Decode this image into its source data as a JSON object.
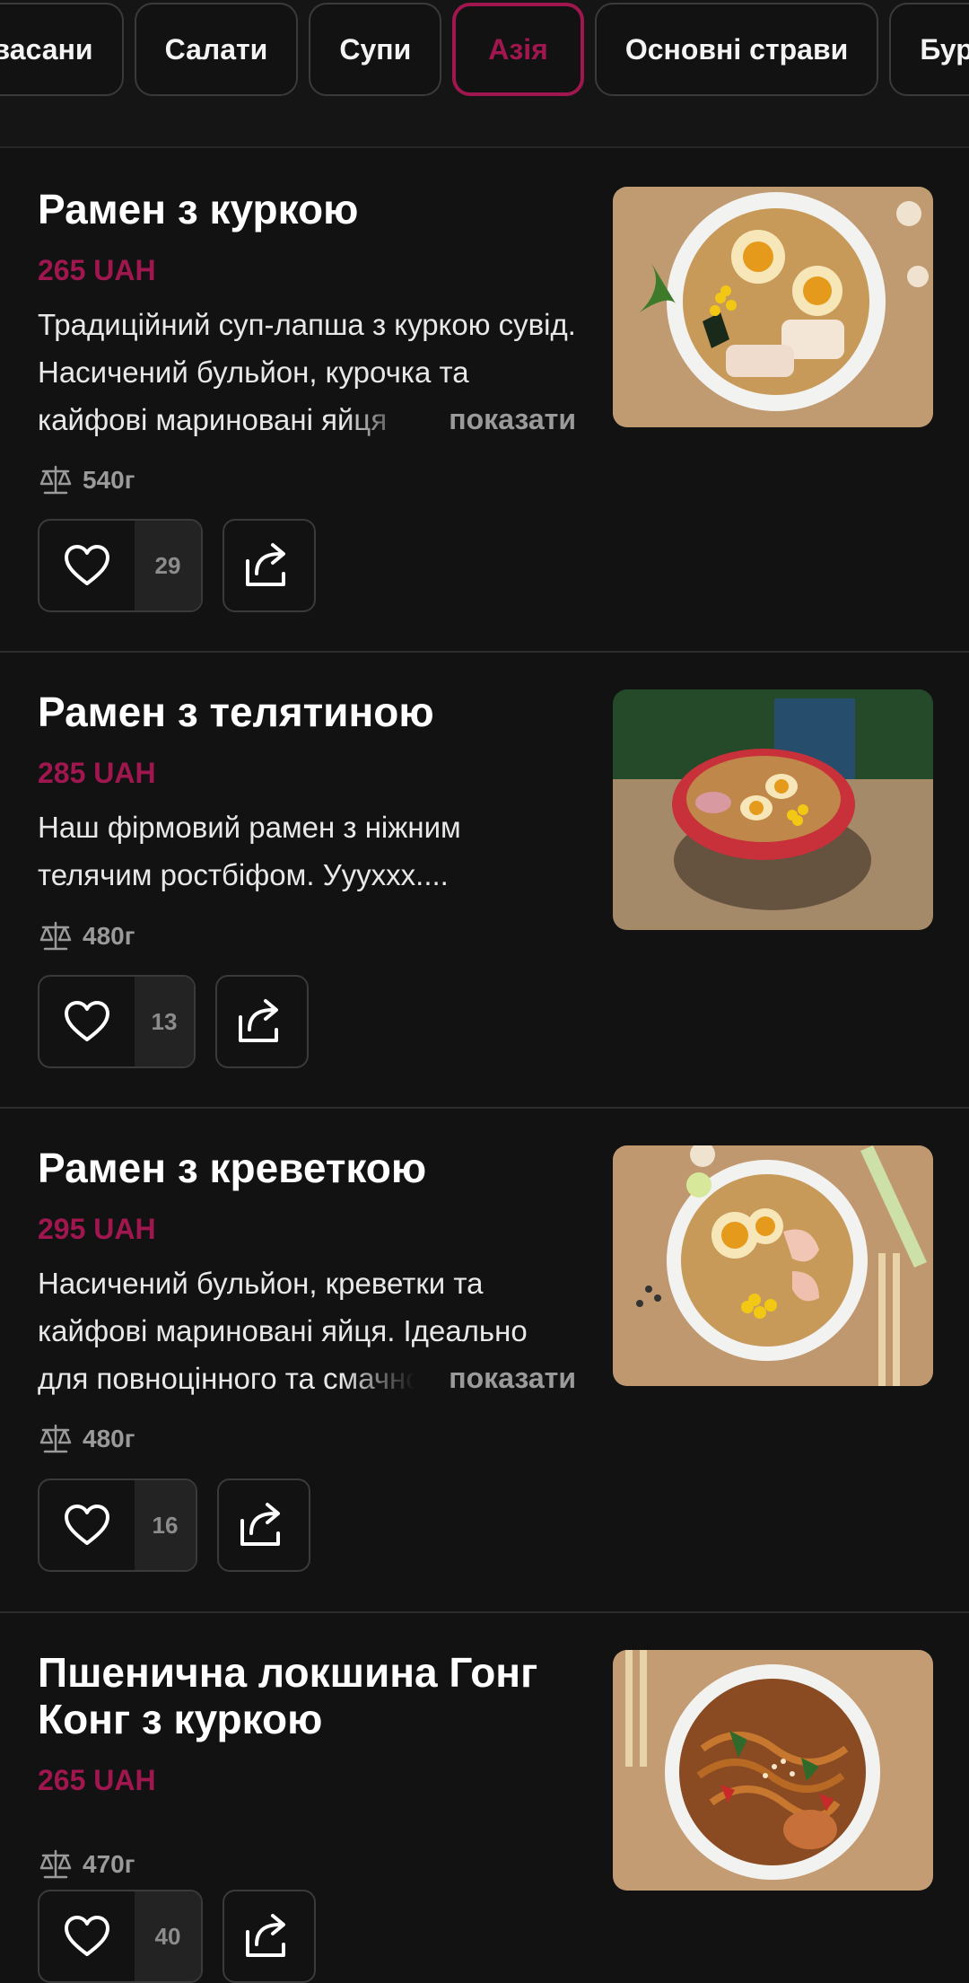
{
  "tabs": [
    {
      "label": "Квасани",
      "active": false
    },
    {
      "label": "Салати",
      "active": false
    },
    {
      "label": "Супи",
      "active": false
    },
    {
      "label": "Азія",
      "active": true
    },
    {
      "label": "Основні страви",
      "active": false
    },
    {
      "label": "Бургери",
      "active": false
    }
  ],
  "items": [
    {
      "title": "Рамен з куркою",
      "price": "265 UAH",
      "description": "Традиційний суп-лапша з куркою сувід. Насичений бульйон, курочка та кайфові мариновані яйця",
      "show_more": "показати",
      "weight": "540г",
      "likes": "29"
    },
    {
      "title": "Рамен з телятиною",
      "price": "285 UAH",
      "description": "Наш фірмовий рамен з ніжним телячим ростбіфом. Уууххх....",
      "weight": "480г",
      "likes": "13"
    },
    {
      "title": "Рамен з креветкою",
      "price": "295 UAH",
      "description": "Насичений бульйон, креветки та кайфові мариновані яйця. Ідеально для повноцінного та смачного",
      "show_more": "показати",
      "weight": "480г",
      "likes": "16"
    },
    {
      "title": "Пшенична локшина Гонг Конг з куркою",
      "price": "265 UAH",
      "weight": "470г",
      "likes": "40"
    }
  ],
  "colors": {
    "accent": "#a0164f",
    "background": "#121212",
    "muted": "#9a9a9a"
  },
  "icons": [
    "heart-icon",
    "share-icon",
    "scale-icon"
  ]
}
